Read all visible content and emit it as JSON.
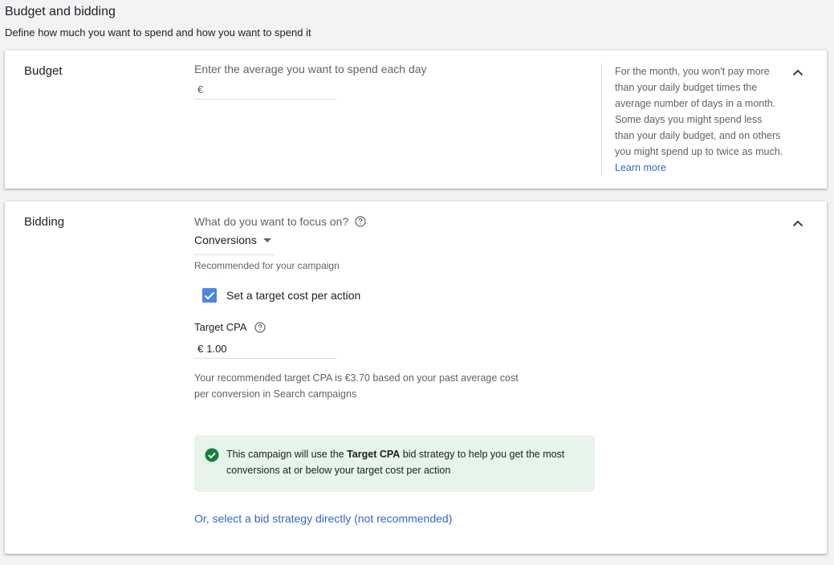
{
  "header": {
    "title": "Budget and bidding",
    "subtitle": "Define how much you want to spend and how you want to spend it"
  },
  "budget": {
    "label": "Budget",
    "prompt": "Enter the average you want to spend each day",
    "currency_symbol": "€",
    "value": "",
    "side_note": "For the month, you won't pay more than your daily budget times the average number of days in a month. Some days you might spend less than your daily budget, and on others you might spend up to twice as much.",
    "learn_more": "Learn more",
    "collapse_icon": "chevron-up-icon"
  },
  "bidding": {
    "label": "Bidding",
    "focus_prompt": "What do you want to focus on?",
    "help_icon": "help-circle-icon",
    "focus_value": "Conversions",
    "recommended_note": "Recommended for your campaign",
    "checkbox_label": "Set a target cost per action",
    "checkbox_checked": true,
    "target_cpa_label": "Target CPA",
    "target_cpa_currency": "€",
    "target_cpa_value": "1.00",
    "recommend_text": "Your recommended target CPA is €3.70 based on your past average cost per conversion in Search campaigns",
    "info_pre": "This campaign will use the ",
    "info_bold": "Target CPA",
    "info_post": " bid strategy to help you get the most conversions at or below your target cost per action",
    "select_strategy_link": "Or, select a bid strategy directly (not recommended)",
    "collapse_icon": "chevron-up-icon"
  },
  "colors": {
    "accent_blue": "#4a86e8",
    "link_blue": "#3367d6",
    "success_green": "#188038",
    "success_bg": "#e6f4ea"
  }
}
